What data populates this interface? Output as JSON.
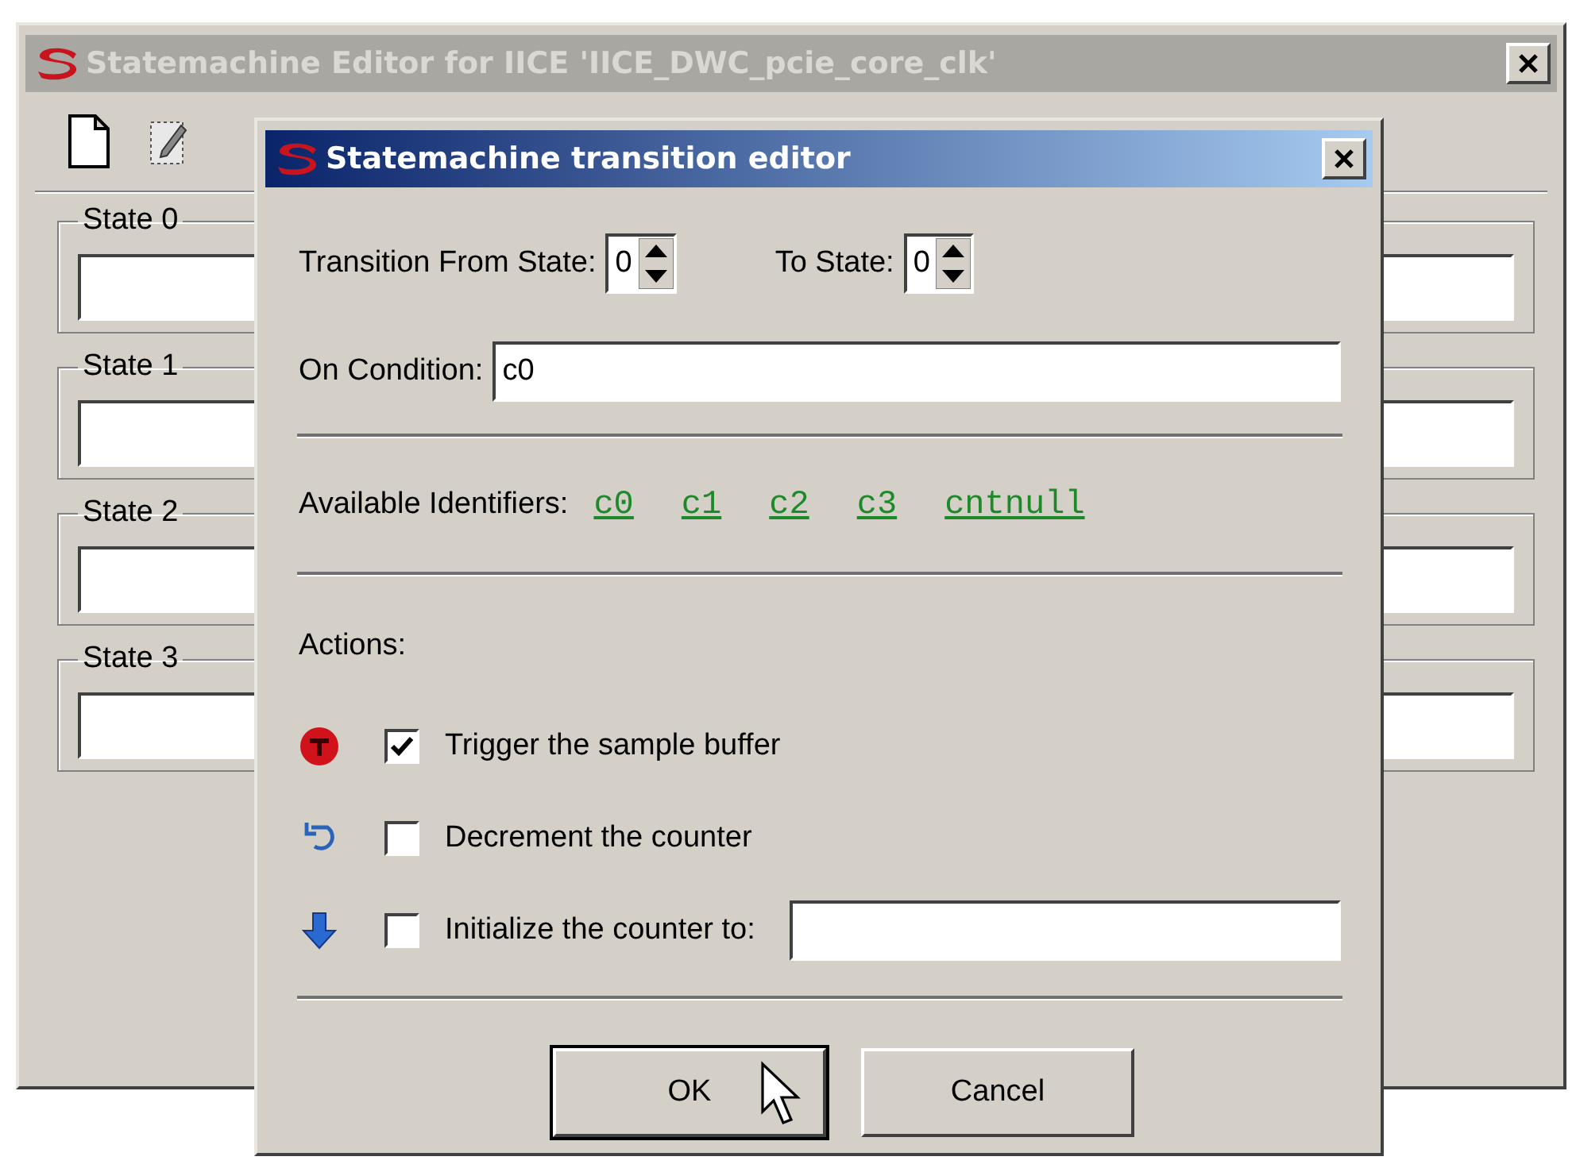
{
  "main_window": {
    "title": "Statemachine Editor for IICE 'IICE_DWC_pcie_core_clk'",
    "active": false
  },
  "states": [
    {
      "label": "State 0"
    },
    {
      "label": "State 1"
    },
    {
      "label": "State 2"
    },
    {
      "label": "State 3"
    }
  ],
  "dialog": {
    "title": "Statemachine transition editor",
    "active": true,
    "from_label": "Transition From State:",
    "from_value": "0",
    "to_label": "To State:",
    "to_value": "0",
    "condition_label": "On Condition:",
    "condition_value": "c0",
    "identifiers_label": "Available Identifiers:",
    "identifiers": [
      "c0",
      "c1",
      "c2",
      "c3",
      "cntnull"
    ],
    "actions_label": "Actions:",
    "actions": [
      {
        "kind": "trigger",
        "label": "Trigger the sample buffer",
        "checked": true
      },
      {
        "kind": "decrement",
        "label": "Decrement the counter",
        "checked": false
      },
      {
        "kind": "initialize",
        "label": "Initialize the counter to:",
        "checked": false
      }
    ],
    "buttons": [
      {
        "label": "OK",
        "focused": true
      },
      {
        "label": "Cancel",
        "focused": false
      }
    ]
  }
}
